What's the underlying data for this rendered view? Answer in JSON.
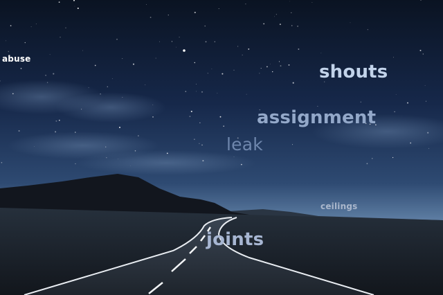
{
  "scene": {
    "description_icon": "night-road-landscape",
    "colors": {
      "sky_top": "#0a1322",
      "sky_horizon": "#5f7fa4",
      "hills": "#12161e",
      "ground": "#1c232d",
      "road": "#28303b",
      "road_line": "#e9edf2"
    }
  },
  "words": {
    "abuse": "abuse",
    "shouts": "shouts",
    "assignment": "assignment",
    "leak": "leak",
    "ceilings": "ceilings",
    "joints": "joints"
  }
}
